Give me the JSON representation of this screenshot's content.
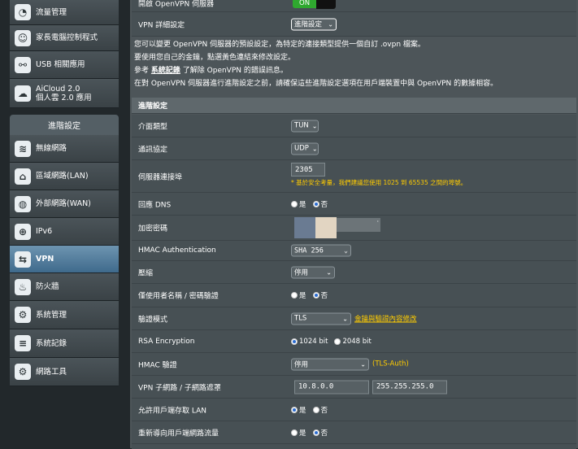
{
  "sidebar": {
    "top_items": [
      {
        "label": "流量管理",
        "icon": "traffic-gauge-icon"
      },
      {
        "label": "家長電腦控制程式",
        "icon": "parental-control-icon"
      },
      {
        "label": "USB 相關應用",
        "icon": "usb-icon"
      },
      {
        "label1": "AiCloud 2.0",
        "label2": "個人雲 2.0 應用",
        "icon": "cloud-icon"
      }
    ],
    "section_title": "進階設定",
    "adv_items": [
      {
        "label": "無線網路",
        "icon": "wireless-icon"
      },
      {
        "label": "區域網路(LAN)",
        "icon": "lan-icon"
      },
      {
        "label": "外部網路(WAN)",
        "icon": "wan-globe-icon"
      },
      {
        "label": "IPv6",
        "icon": "ipv6-icon"
      },
      {
        "label": "VPN",
        "icon": "vpn-icon",
        "active": true
      },
      {
        "label": "防火牆",
        "icon": "firewall-icon"
      },
      {
        "label": "系統管理",
        "icon": "admin-gear-icon"
      },
      {
        "label": "系統記錄",
        "icon": "log-icon"
      },
      {
        "label": "網路工具",
        "icon": "tools-icon"
      }
    ]
  },
  "top": {
    "server_enable_label": "開啟 OpenVPN 伺服器",
    "server_toggle": "ON",
    "details_label": "VPN 詳細設定",
    "details_value": "進階設定"
  },
  "description": {
    "line1": "您可以變更 OpenVPN 伺服器的預設設定，為特定的連接類型提供一個自訂 .ovpn 檔案。",
    "line2": "要使用您自己的金鑰，點選黃色連結來修改設定。",
    "line3_pre": "參考",
    "line3_link": "系統記錄",
    "line3_post": "了解除 OpenVPN 的錯誤訊息。",
    "line4": "在對 OpenVPN 伺服器進行進階設定之前，請確保這些進階設定選項在用戶端裝置中與 OpenVPN 的數據相容。"
  },
  "advanced": {
    "header": "進階設定",
    "interface_label": "介面類型",
    "interface_value": "TUN",
    "protocol_label": "通訊協定",
    "protocol_value": "UDP",
    "port_label": "伺服器連接埠",
    "port_value": "2305",
    "port_note": "* 基於安全考量，我們建議您使用 1025 到 65535 之間的埠號。",
    "dns_label": "回應 DNS",
    "yes": "是",
    "no": "否",
    "encryption_label": "加密密碼",
    "encryption_tail": "·",
    "hmac_auth_label": "HMAC Authentication",
    "hmac_auth_value": "SHA 256",
    "compress_label": "壓縮",
    "compress_value": "停用",
    "userpass_label": "僅使用者名稱 / 密碼驗證",
    "auth_mode_label": "驗證模式",
    "auth_mode_value": "TLS",
    "auth_mode_link": "金鑰與驗證內容修改",
    "rsa_label": "RSA Encryption",
    "rsa_1024": "1024 bit",
    "rsa_2048": "2048 bit",
    "hmac_sig_label": "HMAC 驗證",
    "hmac_sig_value": "停用",
    "hmac_sig_note": "(TLS-Auth)",
    "subnet_label": "VPN 子網路 / 子網路遮罩",
    "subnet_value": "10.8.0.0",
    "mask_value": "255.255.255.0",
    "lan_access_label": "允許用戶端存取 LAN",
    "redirect_label": "重新導向用戶端網路流量"
  },
  "colors": {
    "toggle_green": "#2fa82f",
    "note_yellow": "#ffcc00",
    "active_blue": "#4f7fa3"
  }
}
